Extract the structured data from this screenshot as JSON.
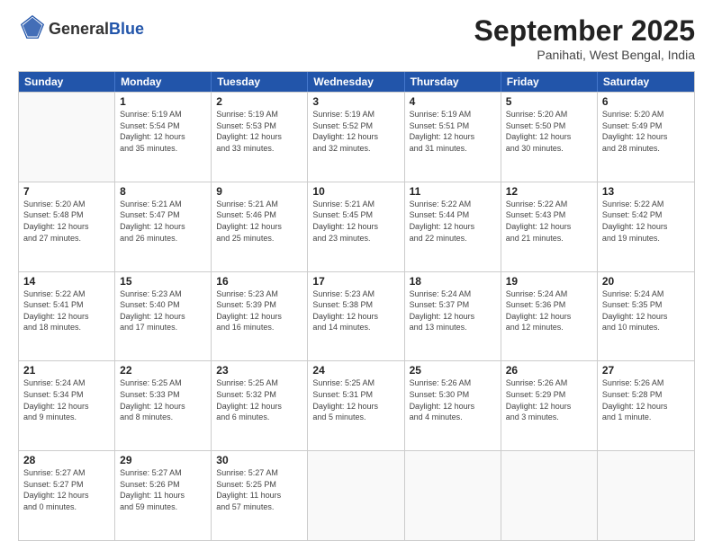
{
  "header": {
    "logo": {
      "line1": "General",
      "line2": "Blue"
    },
    "title": "September 2025",
    "location": "Panihati, West Bengal, India"
  },
  "weekdays": [
    "Sunday",
    "Monday",
    "Tuesday",
    "Wednesday",
    "Thursday",
    "Friday",
    "Saturday"
  ],
  "rows": [
    [
      {
        "day": "",
        "info": ""
      },
      {
        "day": "1",
        "info": "Sunrise: 5:19 AM\nSunset: 5:54 PM\nDaylight: 12 hours\nand 35 minutes."
      },
      {
        "day": "2",
        "info": "Sunrise: 5:19 AM\nSunset: 5:53 PM\nDaylight: 12 hours\nand 33 minutes."
      },
      {
        "day": "3",
        "info": "Sunrise: 5:19 AM\nSunset: 5:52 PM\nDaylight: 12 hours\nand 32 minutes."
      },
      {
        "day": "4",
        "info": "Sunrise: 5:19 AM\nSunset: 5:51 PM\nDaylight: 12 hours\nand 31 minutes."
      },
      {
        "day": "5",
        "info": "Sunrise: 5:20 AM\nSunset: 5:50 PM\nDaylight: 12 hours\nand 30 minutes."
      },
      {
        "day": "6",
        "info": "Sunrise: 5:20 AM\nSunset: 5:49 PM\nDaylight: 12 hours\nand 28 minutes."
      }
    ],
    [
      {
        "day": "7",
        "info": "Sunrise: 5:20 AM\nSunset: 5:48 PM\nDaylight: 12 hours\nand 27 minutes."
      },
      {
        "day": "8",
        "info": "Sunrise: 5:21 AM\nSunset: 5:47 PM\nDaylight: 12 hours\nand 26 minutes."
      },
      {
        "day": "9",
        "info": "Sunrise: 5:21 AM\nSunset: 5:46 PM\nDaylight: 12 hours\nand 25 minutes."
      },
      {
        "day": "10",
        "info": "Sunrise: 5:21 AM\nSunset: 5:45 PM\nDaylight: 12 hours\nand 23 minutes."
      },
      {
        "day": "11",
        "info": "Sunrise: 5:22 AM\nSunset: 5:44 PM\nDaylight: 12 hours\nand 22 minutes."
      },
      {
        "day": "12",
        "info": "Sunrise: 5:22 AM\nSunset: 5:43 PM\nDaylight: 12 hours\nand 21 minutes."
      },
      {
        "day": "13",
        "info": "Sunrise: 5:22 AM\nSunset: 5:42 PM\nDaylight: 12 hours\nand 19 minutes."
      }
    ],
    [
      {
        "day": "14",
        "info": "Sunrise: 5:22 AM\nSunset: 5:41 PM\nDaylight: 12 hours\nand 18 minutes."
      },
      {
        "day": "15",
        "info": "Sunrise: 5:23 AM\nSunset: 5:40 PM\nDaylight: 12 hours\nand 17 minutes."
      },
      {
        "day": "16",
        "info": "Sunrise: 5:23 AM\nSunset: 5:39 PM\nDaylight: 12 hours\nand 16 minutes."
      },
      {
        "day": "17",
        "info": "Sunrise: 5:23 AM\nSunset: 5:38 PM\nDaylight: 12 hours\nand 14 minutes."
      },
      {
        "day": "18",
        "info": "Sunrise: 5:24 AM\nSunset: 5:37 PM\nDaylight: 12 hours\nand 13 minutes."
      },
      {
        "day": "19",
        "info": "Sunrise: 5:24 AM\nSunset: 5:36 PM\nDaylight: 12 hours\nand 12 minutes."
      },
      {
        "day": "20",
        "info": "Sunrise: 5:24 AM\nSunset: 5:35 PM\nDaylight: 12 hours\nand 10 minutes."
      }
    ],
    [
      {
        "day": "21",
        "info": "Sunrise: 5:24 AM\nSunset: 5:34 PM\nDaylight: 12 hours\nand 9 minutes."
      },
      {
        "day": "22",
        "info": "Sunrise: 5:25 AM\nSunset: 5:33 PM\nDaylight: 12 hours\nand 8 minutes."
      },
      {
        "day": "23",
        "info": "Sunrise: 5:25 AM\nSunset: 5:32 PM\nDaylight: 12 hours\nand 6 minutes."
      },
      {
        "day": "24",
        "info": "Sunrise: 5:25 AM\nSunset: 5:31 PM\nDaylight: 12 hours\nand 5 minutes."
      },
      {
        "day": "25",
        "info": "Sunrise: 5:26 AM\nSunset: 5:30 PM\nDaylight: 12 hours\nand 4 minutes."
      },
      {
        "day": "26",
        "info": "Sunrise: 5:26 AM\nSunset: 5:29 PM\nDaylight: 12 hours\nand 3 minutes."
      },
      {
        "day": "27",
        "info": "Sunrise: 5:26 AM\nSunset: 5:28 PM\nDaylight: 12 hours\nand 1 minute."
      }
    ],
    [
      {
        "day": "28",
        "info": "Sunrise: 5:27 AM\nSunset: 5:27 PM\nDaylight: 12 hours\nand 0 minutes."
      },
      {
        "day": "29",
        "info": "Sunrise: 5:27 AM\nSunset: 5:26 PM\nDaylight: 11 hours\nand 59 minutes."
      },
      {
        "day": "30",
        "info": "Sunrise: 5:27 AM\nSunset: 5:25 PM\nDaylight: 11 hours\nand 57 minutes."
      },
      {
        "day": "",
        "info": ""
      },
      {
        "day": "",
        "info": ""
      },
      {
        "day": "",
        "info": ""
      },
      {
        "day": "",
        "info": ""
      }
    ]
  ]
}
